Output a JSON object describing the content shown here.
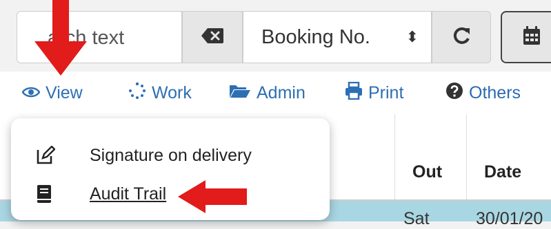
{
  "search": {
    "placeholder": "Search text",
    "visible_placeholder": "arch text",
    "field_selected": "Booking No."
  },
  "toolbar": {
    "items": [
      {
        "label": "View",
        "icon": "eye-icon"
      },
      {
        "label": "Work",
        "icon": "spinner-icon"
      },
      {
        "label": "Admin",
        "icon": "folder-open-icon"
      },
      {
        "label": "Print",
        "icon": "print-icon"
      },
      {
        "label": "Others",
        "icon": "question-circle-icon"
      }
    ]
  },
  "grid": {
    "headers": {
      "out": "Out",
      "date": "Date"
    },
    "row": {
      "day": "Sat",
      "date": "30/01/20"
    }
  },
  "view_menu": {
    "items": [
      {
        "label": "Signature on delivery",
        "icon": "edit-icon"
      },
      {
        "label": " Audit Trail",
        "icon": "book-icon"
      }
    ]
  },
  "colors": {
    "accent": "#2d6fb3",
    "annotation_arrow": "#e21b1b",
    "selected_row": "#a9d6e3"
  }
}
